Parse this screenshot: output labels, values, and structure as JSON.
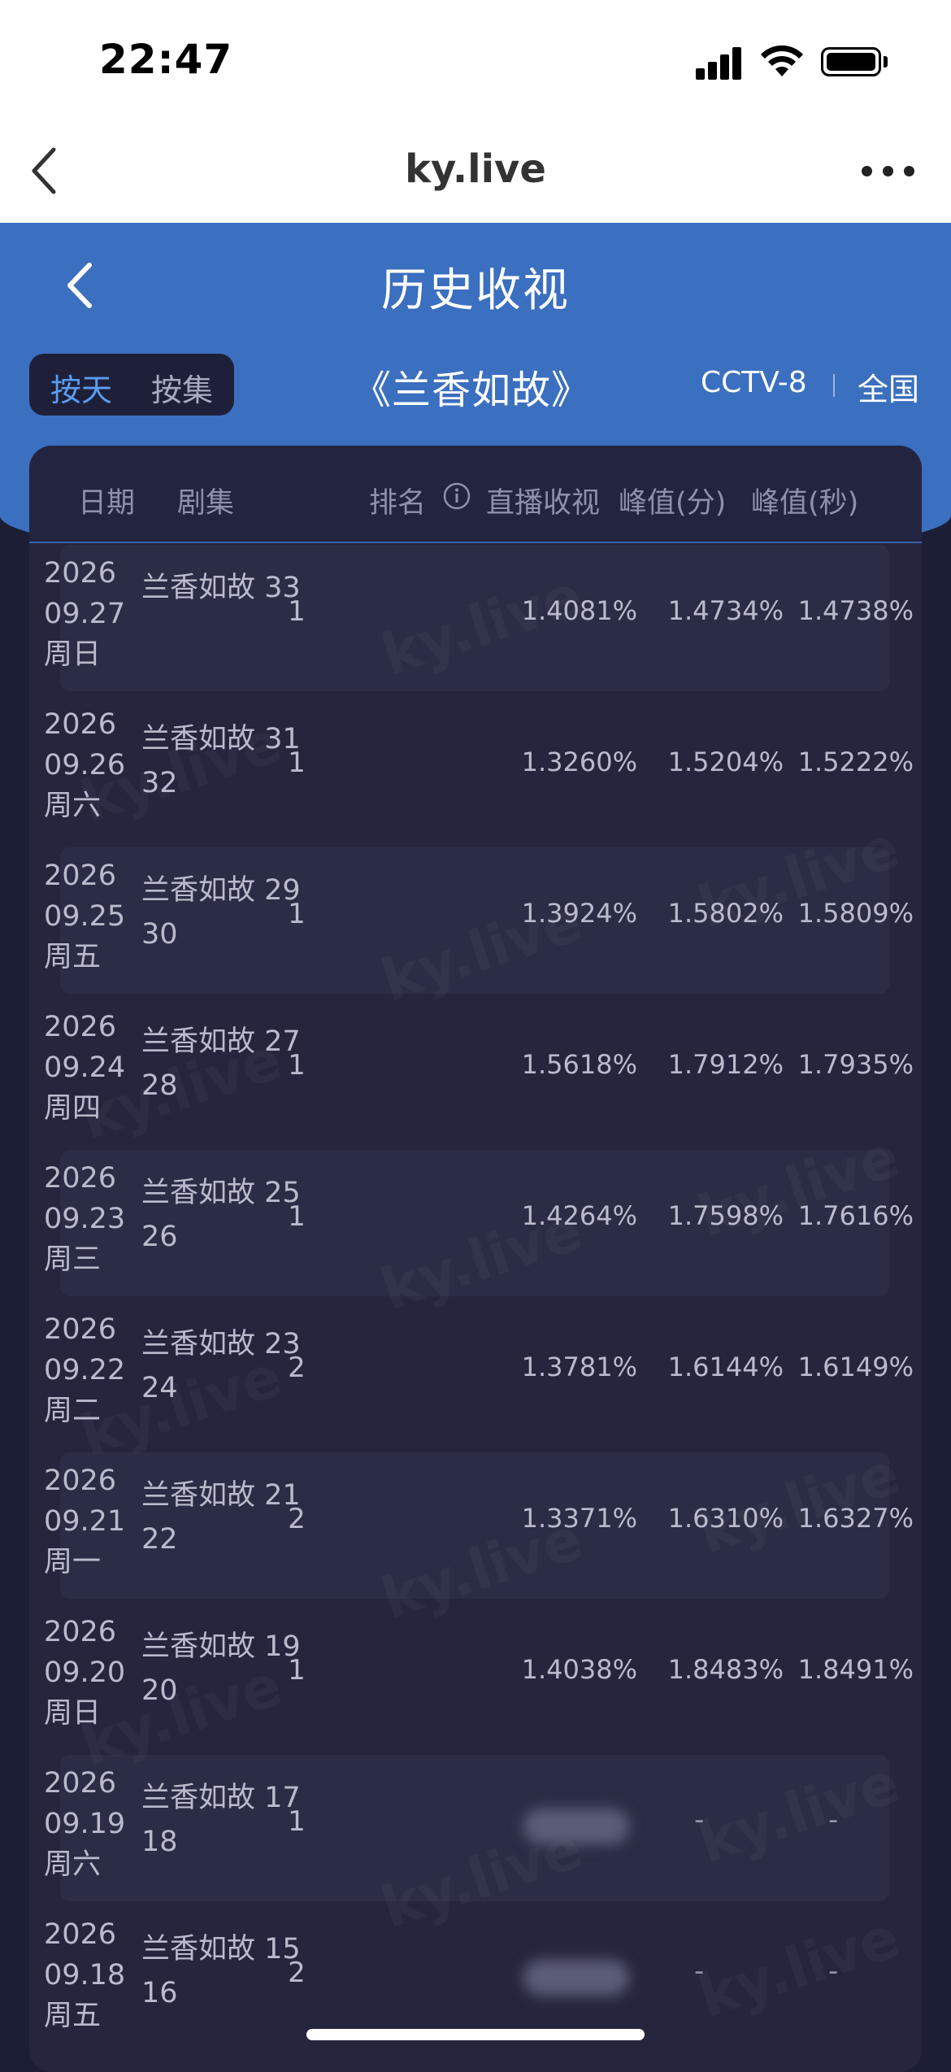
{
  "status_bar": {
    "time": "22:47"
  },
  "browser": {
    "title": "ky.live"
  },
  "page": {
    "title": "历史收视"
  },
  "mode": {
    "by_day": "按天",
    "by_set": "按集"
  },
  "show": {
    "title": "《兰香如故》",
    "channel": "CCTV-8",
    "region": "全国"
  },
  "table": {
    "headers": {
      "date": "日期",
      "episode": "剧集",
      "rank": "排名",
      "live": "直播收视",
      "peak_min": "峰值(分)",
      "peak_sec": "峰值(秒)"
    },
    "rows": [
      {
        "year": "2026",
        "date": "09.27",
        "weekday": "周日",
        "ep1": "兰香如故 33",
        "ep2": "",
        "rank": "1",
        "live": "1.4081%",
        "peak_min": "1.4734%",
        "peak_sec": "1.4738%"
      },
      {
        "year": "2026",
        "date": "09.26",
        "weekday": "周六",
        "ep1": "兰香如故 31",
        "ep2": "32",
        "rank": "1",
        "live": "1.3260%",
        "peak_min": "1.5204%",
        "peak_sec": "1.5222%"
      },
      {
        "year": "2026",
        "date": "09.25",
        "weekday": "周五",
        "ep1": "兰香如故 29",
        "ep2": "30",
        "rank": "1",
        "live": "1.3924%",
        "peak_min": "1.5802%",
        "peak_sec": "1.5809%"
      },
      {
        "year": "2026",
        "date": "09.24",
        "weekday": "周四",
        "ep1": "兰香如故 27",
        "ep2": "28",
        "rank": "1",
        "live": "1.5618%",
        "peak_min": "1.7912%",
        "peak_sec": "1.7935%"
      },
      {
        "year": "2026",
        "date": "09.23",
        "weekday": "周三",
        "ep1": "兰香如故 25",
        "ep2": "26",
        "rank": "1",
        "live": "1.4264%",
        "peak_min": "1.7598%",
        "peak_sec": "1.7616%"
      },
      {
        "year": "2026",
        "date": "09.22",
        "weekday": "周二",
        "ep1": "兰香如故 23",
        "ep2": "24",
        "rank": "2",
        "live": "1.3781%",
        "peak_min": "1.6144%",
        "peak_sec": "1.6149%"
      },
      {
        "year": "2026",
        "date": "09.21",
        "weekday": "周一",
        "ep1": "兰香如故 21",
        "ep2": "22",
        "rank": "2",
        "live": "1.3371%",
        "peak_min": "1.6310%",
        "peak_sec": "1.6327%"
      },
      {
        "year": "2026",
        "date": "09.20",
        "weekday": "周日",
        "ep1": "兰香如故 19",
        "ep2": "20",
        "rank": "1",
        "live": "1.4038%",
        "peak_min": "1.8483%",
        "peak_sec": "1.8491%"
      },
      {
        "year": "2026",
        "date": "09.19",
        "weekday": "周六",
        "ep1": "兰香如故 17",
        "ep2": "18",
        "rank": "1",
        "live": "",
        "peak_min": "-",
        "peak_sec": "-"
      },
      {
        "year": "2026",
        "date": "09.18",
        "weekday": "周五",
        "ep1": "兰香如故 15",
        "ep2": "16",
        "rank": "2",
        "live": "",
        "peak_min": "-",
        "peak_sec": "-"
      }
    ]
  },
  "watermark": {
    "text": "ky.live"
  },
  "icons": {
    "browser_back": "chevron-left-icon",
    "more": "more-dots-icon",
    "page_back": "chevron-left-icon",
    "info": "info-circle-icon"
  },
  "colors": {
    "header_blue": "#3b6fbf",
    "accent": "#5b9cf0",
    "background": "#1c1e36"
  }
}
